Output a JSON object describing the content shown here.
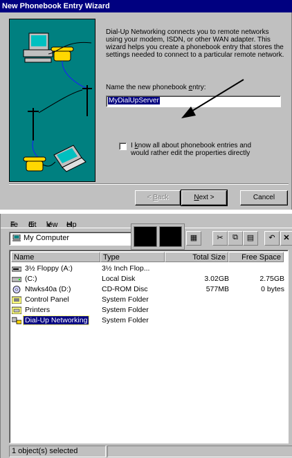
{
  "wizard": {
    "title": "New Phonebook Entry Wizard",
    "intro": "Dial-Up Networking connects you to remote networks using your modem, ISDN, or other WAN adapter.  This wizard helps you create a phonebook entry that stores the settings needed to connect to a particular remote network.",
    "name_label_before": "Name the new phonebook ",
    "name_label_access": "e",
    "name_label_after": "ntry:",
    "entry_value": "MyDialUpServer",
    "checkbox_checked": false,
    "checkbox_pre": "I ",
    "checkbox_access": "k",
    "checkbox_post": "now all about phonebook entries and would rather edit the properties directly",
    "buttons": {
      "back_pre": "< ",
      "back_access": "B",
      "back_post": "ack",
      "next_access": "N",
      "next_post": "ext >",
      "cancel": "Cancel"
    }
  },
  "explorer": {
    "menu": [
      {
        "access": "F",
        "rest": "ile"
      },
      {
        "access": "E",
        "rest": "dit"
      },
      {
        "access": "V",
        "rest": "iew"
      },
      {
        "access": "H",
        "rest": "elp"
      }
    ],
    "address": "My Computer",
    "columns": {
      "name": "Name",
      "type": "Type",
      "total": "Total Size",
      "free": "Free Space"
    },
    "rows": [
      {
        "name": "3½ Floppy (A:)",
        "type": "3½ Inch Flop...",
        "total": "",
        "free": "",
        "icon": "floppy-icon"
      },
      {
        "name": "(C:)",
        "type": "Local Disk",
        "total": "3.02GB",
        "free": "2.75GB",
        "icon": "hard-disk-icon"
      },
      {
        "name": "Ntwks40a (D:)",
        "type": "CD-ROM Disc",
        "total": "577MB",
        "free": "0 bytes",
        "icon": "cdrom-icon"
      },
      {
        "name": "Control Panel",
        "type": "System Folder",
        "total": "",
        "free": "",
        "icon": "control-panel-icon"
      },
      {
        "name": "Printers",
        "type": "System Folder",
        "total": "",
        "free": "",
        "icon": "printers-icon"
      },
      {
        "name": "Dial-Up Networking",
        "type": "System Folder",
        "total": "",
        "free": "",
        "icon": "dialup-networking-icon",
        "selected": true
      }
    ],
    "status": "1 object(s) selected"
  }
}
